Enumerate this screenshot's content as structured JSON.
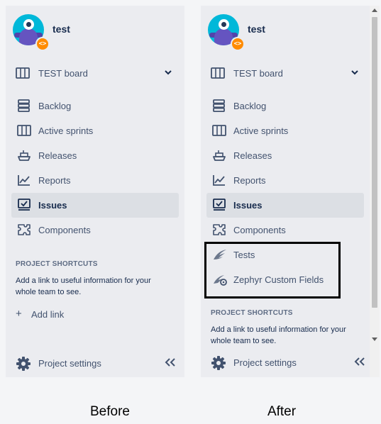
{
  "before": {
    "project_name": "test",
    "board_label": "TEST board",
    "nav_items": [
      {
        "label": "Backlog",
        "icon": "backlog-icon"
      },
      {
        "label": "Active sprints",
        "icon": "active-sprints-icon"
      },
      {
        "label": "Releases",
        "icon": "releases-icon"
      },
      {
        "label": "Reports",
        "icon": "reports-icon"
      },
      {
        "label": "Issues",
        "icon": "issues-icon",
        "active": true
      },
      {
        "label": "Components",
        "icon": "components-icon"
      }
    ],
    "shortcuts_title": "PROJECT SHORTCUTS",
    "shortcuts_desc": "Add a link to useful information for your whole team to see.",
    "add_link_label": "Add link",
    "settings_label": "Project settings"
  },
  "after": {
    "project_name": "test",
    "board_label": "TEST board",
    "nav_items": [
      {
        "label": "Backlog",
        "icon": "backlog-icon"
      },
      {
        "label": "Active sprints",
        "icon": "active-sprints-icon"
      },
      {
        "label": "Releases",
        "icon": "releases-icon"
      },
      {
        "label": "Reports",
        "icon": "reports-icon"
      },
      {
        "label": "Issues",
        "icon": "issues-icon",
        "active": true
      },
      {
        "label": "Components",
        "icon": "components-icon"
      }
    ],
    "zephyr_items": [
      {
        "label": "Tests",
        "icon": "zephyr-wing-icon"
      },
      {
        "label": "Zephyr Custom Fields",
        "icon": "zephyr-custom-fields-icon"
      }
    ],
    "shortcuts_title": "PROJECT SHORTCUTS",
    "shortcuts_desc": "Add a link to useful information for your whole team to see.",
    "settings_label": "Project settings"
  },
  "captions": {
    "before": "Before",
    "after": "After"
  },
  "colors": {
    "panel": "#ebecf0",
    "active_item": "#dcdfe4",
    "avatar": "#00b8d9",
    "badge": "#ff8b00",
    "highlight_border": "#000000"
  }
}
